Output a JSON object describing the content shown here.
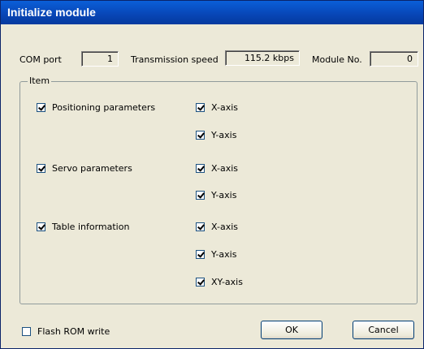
{
  "window": {
    "title": "Initialize module"
  },
  "header": {
    "com_port_label": "COM port",
    "com_port_value": "1",
    "speed_label": "Transmission speed",
    "speed_value": "115.2 kbps",
    "module_no_label": "Module No.",
    "module_no_value": "0"
  },
  "item_group": {
    "label": "Item",
    "sections": [
      {
        "name": "Positioning parameters",
        "checked": true,
        "axes": [
          {
            "label": "X-axis",
            "checked": true
          },
          {
            "label": "Y-axis",
            "checked": true
          }
        ]
      },
      {
        "name": "Servo parameters",
        "checked": true,
        "axes": [
          {
            "label": "X-axis",
            "checked": true
          },
          {
            "label": "Y-axis",
            "checked": true
          }
        ]
      },
      {
        "name": "Table information",
        "checked": true,
        "axes": [
          {
            "label": "X-axis",
            "checked": true
          },
          {
            "label": "Y-axis",
            "checked": true
          },
          {
            "label": "XY-axis",
            "checked": true
          }
        ]
      }
    ]
  },
  "footer": {
    "flash_rom_label": "Flash ROM write",
    "flash_rom_checked": false,
    "ok_label": "OK",
    "cancel_label": "Cancel"
  }
}
